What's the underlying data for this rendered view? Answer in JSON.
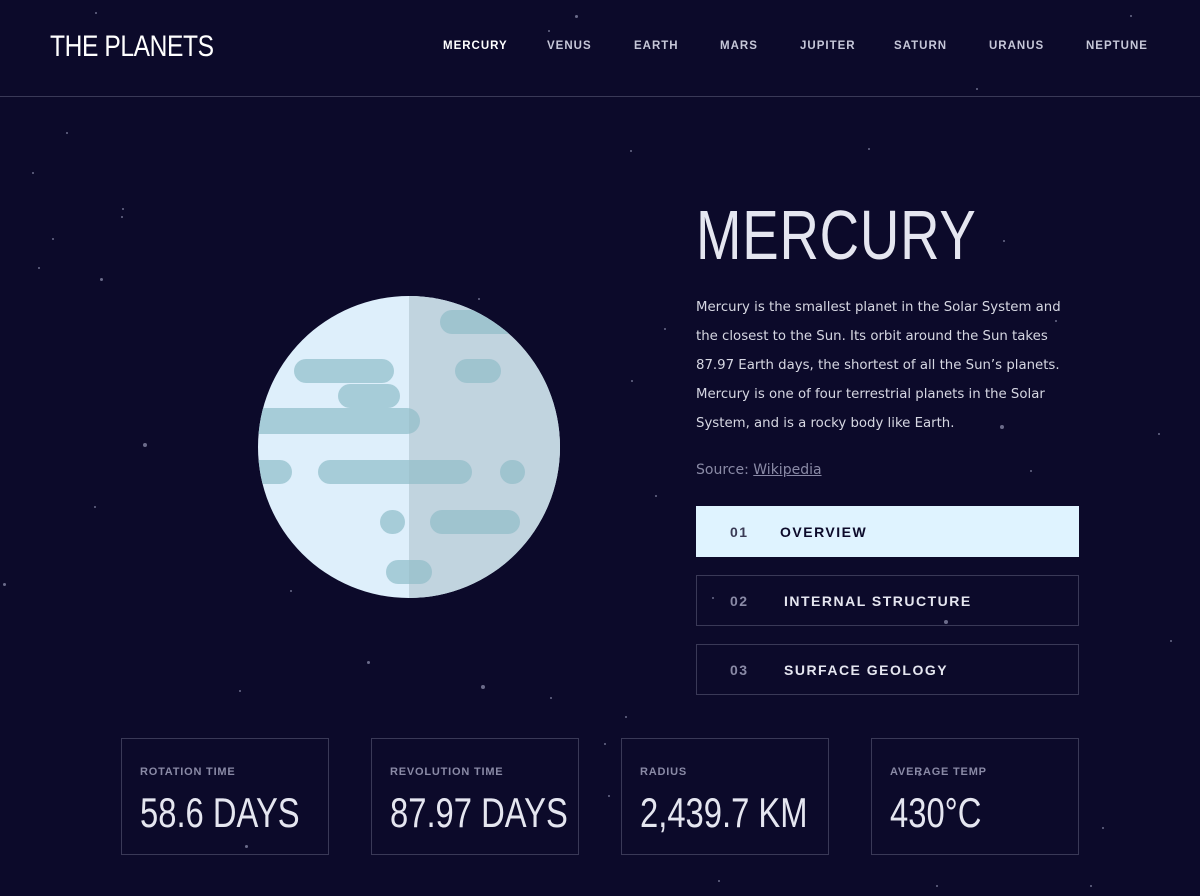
{
  "header": {
    "logo": "THE PLANETS",
    "nav": [
      "MERCURY",
      "VENUS",
      "EARTH",
      "MARS",
      "JUPITER",
      "SATURN",
      "URANUS",
      "NEPTUNE"
    ],
    "active_nav": "MERCURY"
  },
  "planet": {
    "name": "MERCURY",
    "description": "Mercury is the smallest planet in the Solar System and the closest to the Sun. Its orbit around the Sun takes 87.97 Earth days, the shortest of all the Sun’s planets. Mercury is one of four terrestrial planets in the Solar System, and is a rocky body like Earth.",
    "source_label": "Source:",
    "source_link": "Wikipedia",
    "image_icon": "mercury-planet-illustration"
  },
  "tabs": [
    {
      "num": "01",
      "label": "OVERVIEW",
      "active": true
    },
    {
      "num": "02",
      "label": "INTERNAL STRUCTURE",
      "active": false
    },
    {
      "num": "03",
      "label": "SURFACE GEOLOGY",
      "active": false
    }
  ],
  "stats": [
    {
      "label": "ROTATION TIME",
      "value": "58.6 DAYS"
    },
    {
      "label": "REVOLUTION TIME",
      "value": "87.97 DAYS"
    },
    {
      "label": "RADIUS",
      "value": "2,439.7 KM"
    },
    {
      "label": "AVERAGE TEMP",
      "value": "430°C"
    }
  ],
  "colors": {
    "background": "#0c0a2a",
    "active_tab": "#dff3ff",
    "border": "#3a3957",
    "planet_light": "#deeffb",
    "planet_shade": "#c9dde9",
    "planet_craters": "#a6ccd8"
  }
}
